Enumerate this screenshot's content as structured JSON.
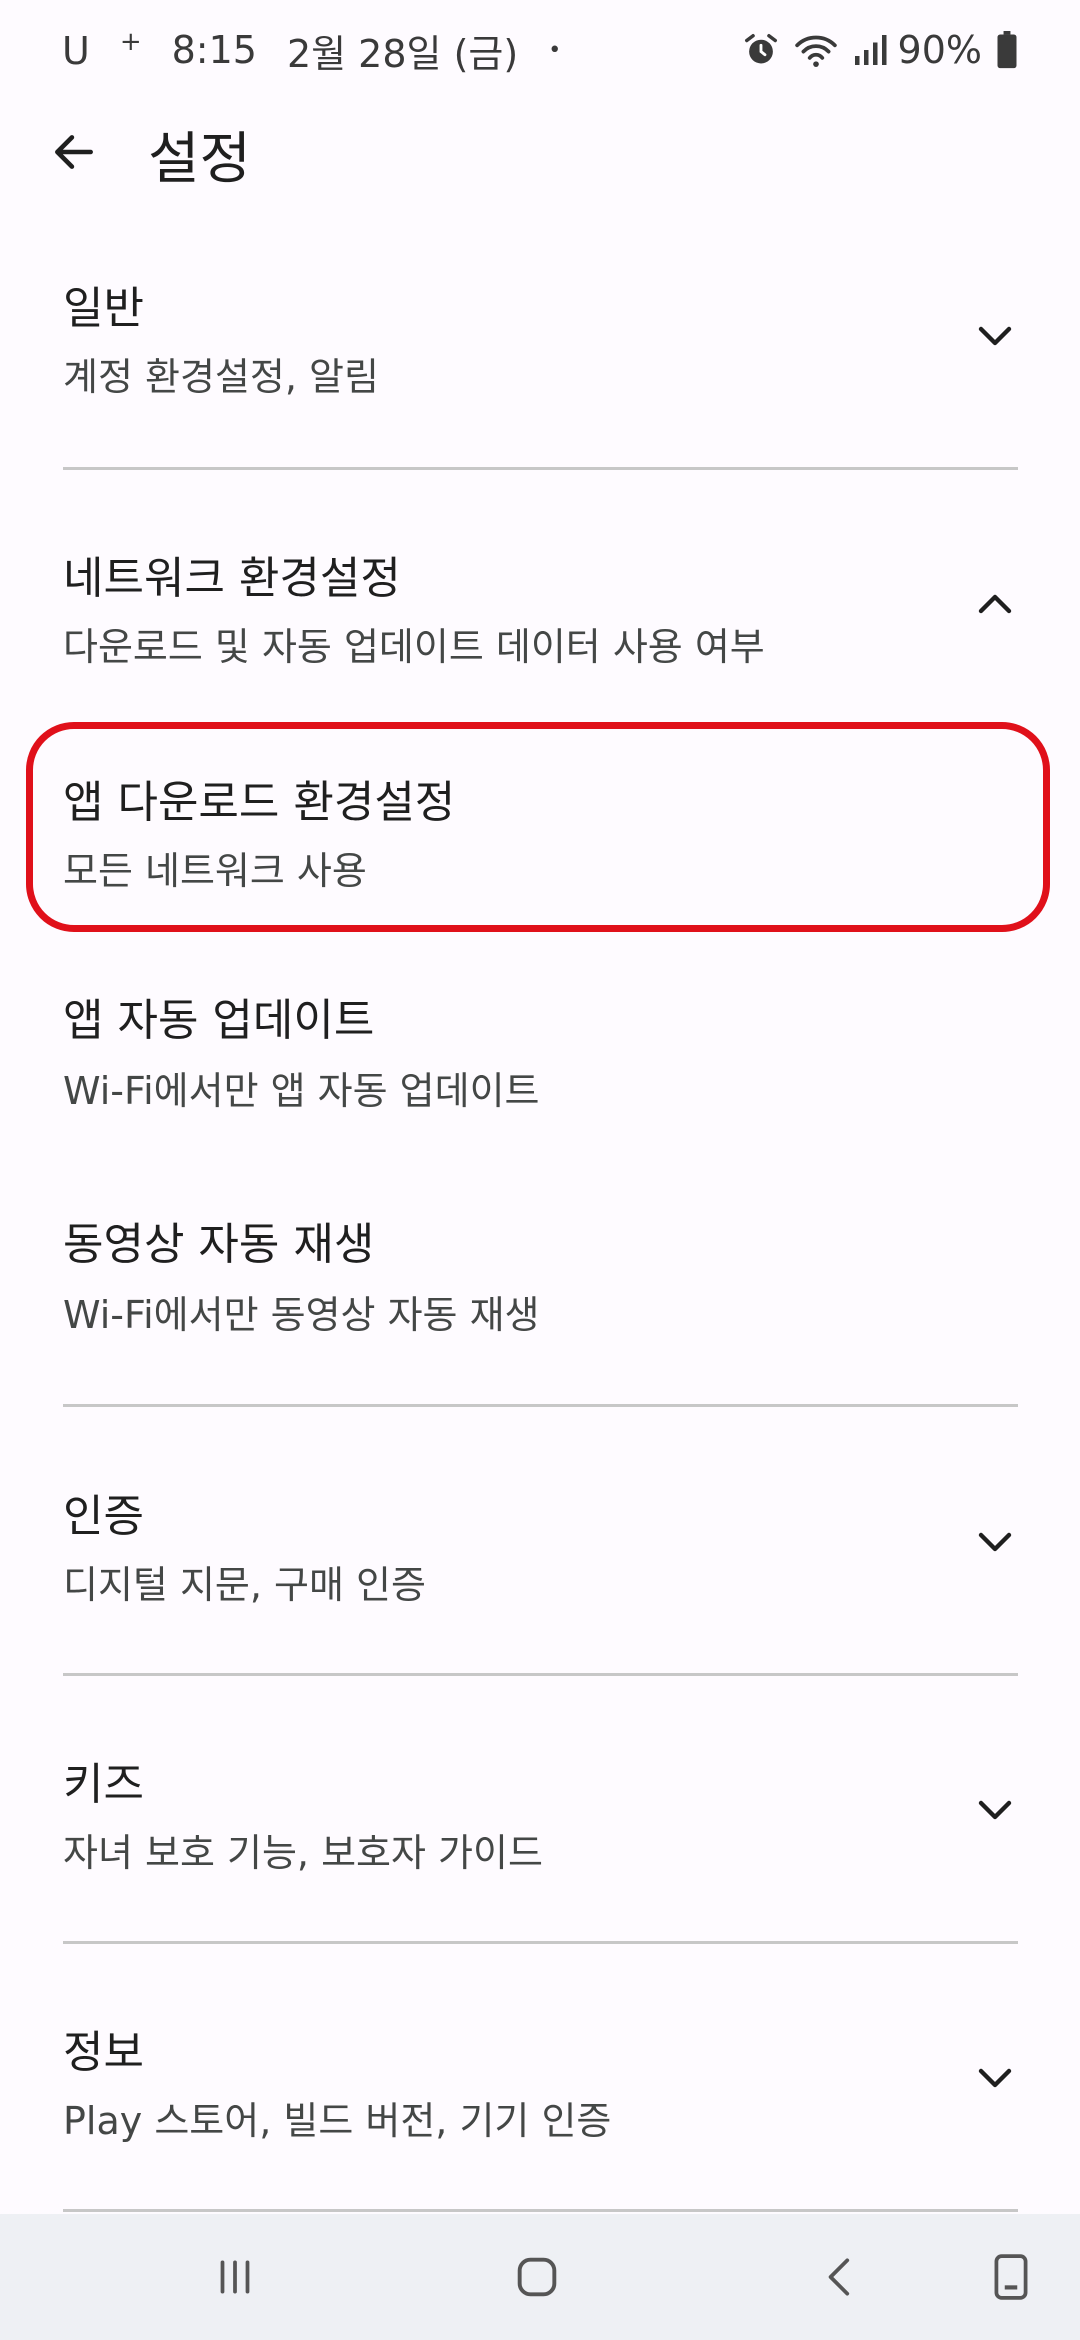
{
  "status": {
    "carrier": "U",
    "carrier_sup": "+",
    "time": "8:15",
    "date": "2월 28일 (금)",
    "dot": "•",
    "battery": "90%",
    "icons": [
      "alarm-icon",
      "wifi-icon",
      "signal-icon",
      "battery-icon"
    ]
  },
  "header": {
    "title": "설정",
    "back_icon": "arrow-left-icon"
  },
  "sections": {
    "general": {
      "title": "일반",
      "subtitle": "계정 환경설정, 알림",
      "expanded": false
    },
    "network": {
      "title": "네트워크 환경설정",
      "subtitle": "다운로드 및 자동 업데이트 데이터 사용 여부",
      "expanded": true,
      "items": [
        {
          "title": "앱 다운로드 환경설정",
          "subtitle": "모든 네트워크 사용",
          "highlighted": true
        },
        {
          "title": "앱 자동 업데이트",
          "subtitle": "Wi-Fi에서만 앱 자동 업데이트"
        },
        {
          "title": "동영상 자동 재생",
          "subtitle": "Wi-Fi에서만 동영상 자동 재생"
        }
      ]
    },
    "auth": {
      "title": "인증",
      "subtitle": "디지털 지문, 구매 인증",
      "expanded": false
    },
    "kids": {
      "title": "키즈",
      "subtitle": "자녀 보호 기능, 보호자 가이드",
      "expanded": false
    },
    "about": {
      "title": "정보",
      "subtitle": "Play 스토어, 빌드 버전, 기기 인증",
      "expanded": false
    }
  },
  "colors": {
    "highlight": "#e0101a",
    "divider": "#c7c7c7",
    "background": "#fefbff"
  },
  "navbar": {
    "icons": [
      "recents-icon",
      "home-icon",
      "back-icon",
      "screenshot-icon"
    ]
  }
}
